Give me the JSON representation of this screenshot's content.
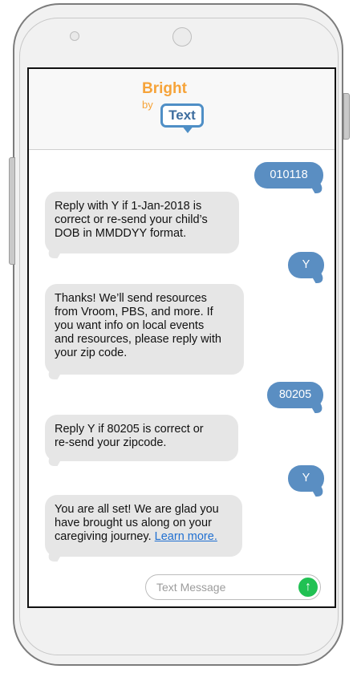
{
  "logo": {
    "bright": "Bright",
    "by": "by",
    "text": "Text"
  },
  "messages": [
    {
      "from": "user",
      "text": "010118"
    },
    {
      "from": "bot",
      "lines": [
        "Reply with Y if 1-Jan-2018 is",
        "correct or re-send your child’s",
        "DOB in MMDDYY format."
      ]
    },
    {
      "from": "user",
      "text": "Y"
    },
    {
      "from": "bot",
      "lines": [
        "Thanks! We’ll send resources",
        "from Vroom, PBS, and more. If",
        "you want info on local events",
        "and resources, please reply with",
        "your zip code."
      ]
    },
    {
      "from": "user",
      "text": "80205"
    },
    {
      "from": "bot",
      "lines": [
        "Reply Y if 80205 is correct or",
        "re-send your zipcode."
      ]
    },
    {
      "from": "user",
      "text": "Y"
    },
    {
      "from": "bot",
      "lines": [
        "You are all set!  We are glad you",
        "have brought us along on your",
        "caregiving journey."
      ],
      "link": "Learn more."
    }
  ],
  "input": {
    "placeholder": "Text Message"
  },
  "send_icon": "up-arrow-icon",
  "colors": {
    "outgoing": "#5a8ec2",
    "incoming": "#e6e6e6",
    "brand_orange": "#f6a339",
    "brand_blue": "#4f8fc6",
    "send": "#21c153"
  }
}
